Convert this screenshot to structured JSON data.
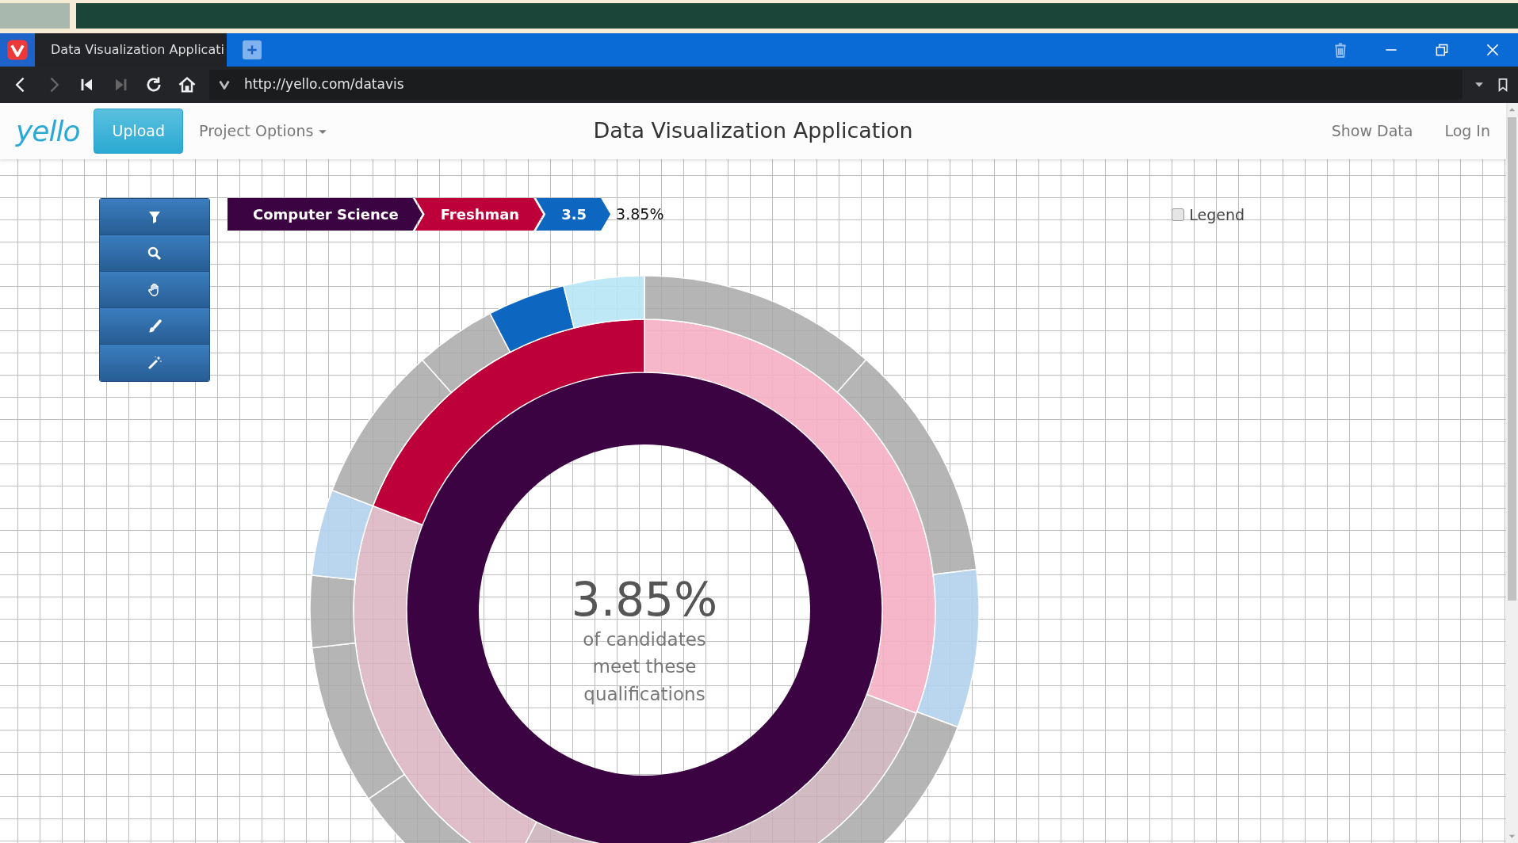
{
  "browser": {
    "tab": {
      "title": "Data Visualization Applicati",
      "selected": true
    },
    "url": "http://yello.com/datavis"
  },
  "navbar": {
    "brand": "yello",
    "upload_button": "Upload",
    "menu": "Project Options",
    "title": "Data Visualization Application",
    "links": [
      "Show Data",
      "Log In"
    ]
  },
  "tools": [
    {
      "kind": "filter"
    },
    {
      "kind": "search"
    },
    {
      "kind": "hand"
    },
    {
      "kind": "brush"
    },
    {
      "kind": "wand"
    }
  ],
  "breadcrumb": [
    {
      "label": "Computer Science",
      "color": "#3b0341"
    },
    {
      "label": "Freshman",
      "color": "#bd003a"
    },
    {
      "label": "3.5",
      "color": "#0d67c0"
    }
  ],
  "breadcrumb_result": "3.85%",
  "legend": {
    "label": "Legend",
    "checked": false
  },
  "summary": {
    "value": "3.85%",
    "caption": "of candidates meet these qualifications"
  }
}
